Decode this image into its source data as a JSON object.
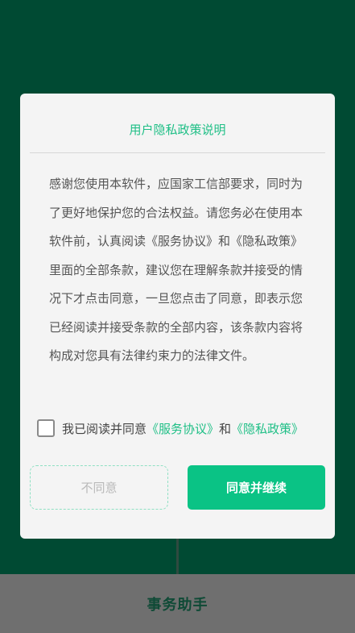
{
  "app": {
    "bottom_title": "事务助手"
  },
  "dialog": {
    "title": "用户隐私政策说明",
    "body": "感谢您使用本软件，应国家工信部要求，同时为了更好地保护您的合法权益。请您务必在使用本软件前，认真阅读《服务协议》和《隐私政策》里面的全部条款，建议您在理解条款并接受的情况下才点击同意，一旦您点击了同意，即表示您已经阅读并接受条款的全部内容，该条款内容将构成对您具有法律约束力的法律文件。",
    "agree_prefix": "我已阅读并同意",
    "service_link": "《服务协议》",
    "and_text": "和",
    "privacy_link": "《隐私政策》",
    "checkbox_checked": false,
    "disagree_label": "不同意",
    "agree_label": "同意并继续"
  },
  "colors": {
    "accent": "#0ac385",
    "link": "#1fbf86",
    "backdrop": "#004a33",
    "bottom_bar": "#6f6f6f"
  }
}
